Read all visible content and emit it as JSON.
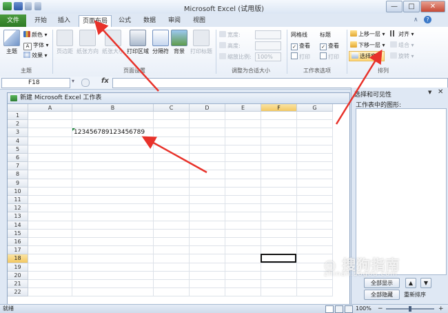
{
  "window": {
    "title": "Microsoft Excel (试用版)",
    "minimize": "—",
    "restore": "□",
    "close": "✕"
  },
  "tabs": {
    "file": "文件",
    "home": "开始",
    "insert": "插入",
    "page_layout": "页面布局",
    "formulas": "公式",
    "data": "数据",
    "review": "审阅",
    "view": "视图"
  },
  "ribbon": {
    "themes_group": {
      "themes": "主题",
      "colors": "颜色",
      "fonts": "字体",
      "effects": "效果",
      "label": "主题"
    },
    "page_setup_group": {
      "margins": "页边距",
      "orientation": "纸张方向",
      "size": "纸张大小",
      "print_area": "打印区域",
      "breaks": "分隔符",
      "background": "背景",
      "print_titles": "打印标题",
      "label": "页面设置"
    },
    "scale_group": {
      "width": "宽度:",
      "height": "高度:",
      "scale": "缩放比例:",
      "scale_value": "100%",
      "label": "调整为合适大小"
    },
    "sheet_options_group": {
      "gridlines": "网格线",
      "headings": "标题",
      "view": "查看",
      "print": "打印",
      "label": "工作表选项"
    },
    "arrange_group": {
      "bring_forward": "上移一层",
      "send_backward": "下移一层",
      "selection_pane": "选择窗格",
      "align": "对齐",
      "group": "组合",
      "rotate": "旋转",
      "label": "排列"
    }
  },
  "formula_bar": {
    "name_box": "F18",
    "fx": "fx"
  },
  "workbook": {
    "title": "新建 Microsoft Excel 工作表",
    "columns": [
      "A",
      "B",
      "C",
      "D",
      "E",
      "F",
      "G"
    ],
    "rows": [
      "1",
      "2",
      "3",
      "4",
      "5",
      "6",
      "7",
      "8",
      "9",
      "10",
      "11",
      "12",
      "13",
      "14",
      "15",
      "16",
      "17",
      "18",
      "19",
      "20",
      "21",
      "22"
    ],
    "cell_b3": "123456789123456789"
  },
  "selection_pane": {
    "title": "选择和可见性",
    "shapes_label": "工作表中的图形:",
    "show_all": "全部显示",
    "hide_all": "全部隐藏",
    "reorder": "重新排序"
  },
  "status_bar": {
    "ready": "就绪",
    "zoom": "100%",
    "minus": "−",
    "plus": "+"
  }
}
